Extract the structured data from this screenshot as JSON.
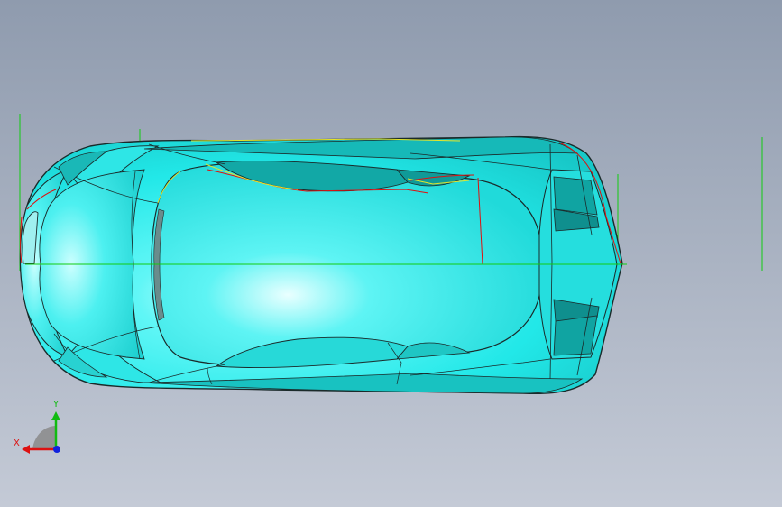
{
  "viewport": {
    "background_top": "#8f9bae",
    "background_bottom": "#c4cad6"
  },
  "model": {
    "body_color": "#22e8e8",
    "body_shadow_color": "#0fb0ae",
    "edge_color": "#1a2a2a",
    "highlight_color": "#e8ffff",
    "sketch_red": "#dd1111",
    "sketch_yellow": "#e6e62a",
    "sketch_green": "#11cc11"
  },
  "triad": {
    "x_label": "X",
    "y_label": "Y",
    "x_color": "#dd1111",
    "y_color": "#11bb11",
    "z_color": "#1122dd"
  }
}
